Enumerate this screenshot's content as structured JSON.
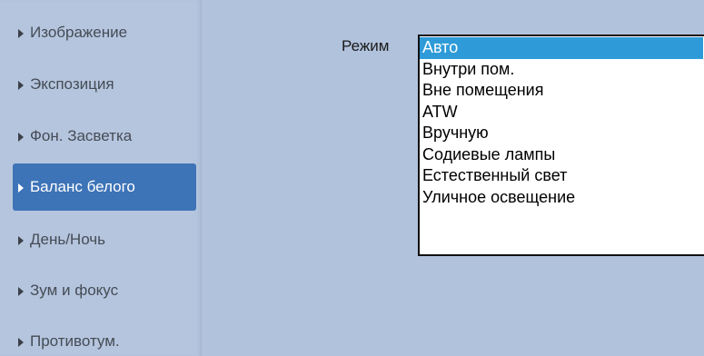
{
  "sidebar": {
    "items": [
      {
        "label": "Изображение",
        "active": false
      },
      {
        "label": "Экспозиция",
        "active": false
      },
      {
        "label": "Фон. Засветка",
        "active": false
      },
      {
        "label": "Баланс белого",
        "active": true
      },
      {
        "label": "День/Ночь",
        "active": false
      },
      {
        "label": "Зум и фокус",
        "active": false
      },
      {
        "label": "Противотум.",
        "active": false
      }
    ]
  },
  "form": {
    "mode_label": "Режим",
    "mode_options": [
      "Авто",
      "Внутри пом.",
      "Вне помещения",
      "ATW",
      "Вручную",
      "Содиевые лампы",
      "Естественный свет",
      "Уличное освещение"
    ],
    "selected_option": "Авто"
  },
  "colors": {
    "background": "#b1c2dc",
    "active_item": "#3d73b7",
    "selected_option": "#2e9bd8"
  }
}
